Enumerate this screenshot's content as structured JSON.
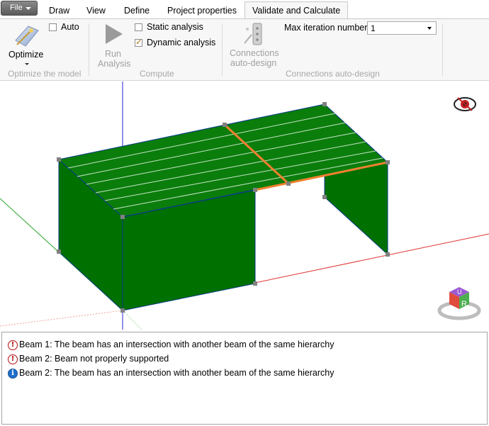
{
  "menu": {
    "file_label": "File",
    "tabs": [
      "Draw",
      "View",
      "Define",
      "Project properties",
      "Validate and Calculate"
    ],
    "active_tab": "Validate and Calculate"
  },
  "ribbon": {
    "optimize": {
      "button_label": "Optimize",
      "auto_label": "Auto",
      "auto_checked": false,
      "group_label": "Optimize the model"
    },
    "compute": {
      "run_label_line1": "Run",
      "run_label_line2": "Analysis",
      "static_label": "Static analysis",
      "static_checked": false,
      "dynamic_label": "Dynamic analysis",
      "dynamic_checked": true,
      "group_label": "Compute"
    },
    "connections": {
      "button_line1": "Connections",
      "button_line2": "auto-design",
      "max_iter_label": "Max iteration number",
      "max_iter_value": "1",
      "group_label": "Connections auto-design"
    }
  },
  "viewport": {
    "cube_labels": {
      "top": "U",
      "front": "R"
    },
    "colors": {
      "wall": "#007000",
      "roof": "#0a7a0a",
      "beam_highlight": "#f08030",
      "x_axis": "#e03030",
      "y_axis": "#20a020",
      "z_axis": "#2020d0"
    }
  },
  "messages": [
    {
      "type": "error",
      "icon": "!",
      "text": "Beam 1: The beam has an intersection with another beam of the same hierarchy"
    },
    {
      "type": "error",
      "icon": "!",
      "text": "Beam 2: Beam not properly supported"
    },
    {
      "type": "info",
      "icon": "i",
      "text": "Beam 2: The beam has an intersection with another beam of the same hierarchy"
    }
  ]
}
